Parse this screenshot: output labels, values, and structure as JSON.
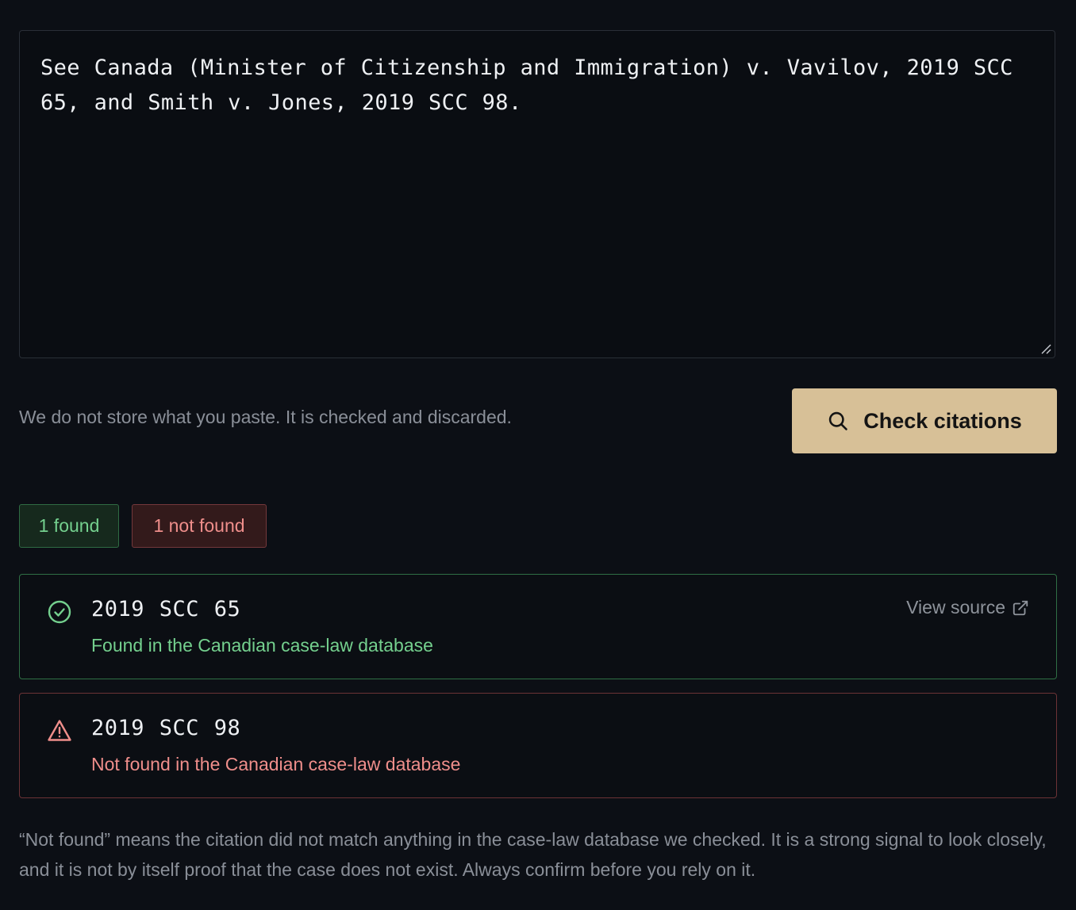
{
  "editor": {
    "text": "See Canada (Minister of Citizenship and Immigration) v. Vavilov, 2019 SCC 65, and Smith v. Jones, 2019 SCC 98."
  },
  "privacy_note": "We do not store what you paste. It is checked and discarded.",
  "check_button": {
    "label": "Check citations",
    "icon": "search-icon"
  },
  "summary": {
    "found_label": "1 found",
    "not_found_label": "1 not found"
  },
  "results": [
    {
      "citation": "2019 SCC 65",
      "status": "found",
      "message": "Found in the Canadian case-law database",
      "link_label": "View source",
      "icon": "check-circle-icon"
    },
    {
      "citation": "2019 SCC 98",
      "status": "not-found",
      "message": "Not found in the Canadian case-law database",
      "icon": "warning-triangle-icon"
    }
  ],
  "disclaimer": "“Not found” means the citation did not match anything in the case-law database we checked. It is a strong signal to look closely, and it is not by itself proof that the case does not exist. Always confirm before you rely on it.",
  "colors": {
    "background": "#0c0f15",
    "accent_button": "#d7c097",
    "found_green": "#74d08e",
    "not_found_red": "#ef8e8b"
  }
}
